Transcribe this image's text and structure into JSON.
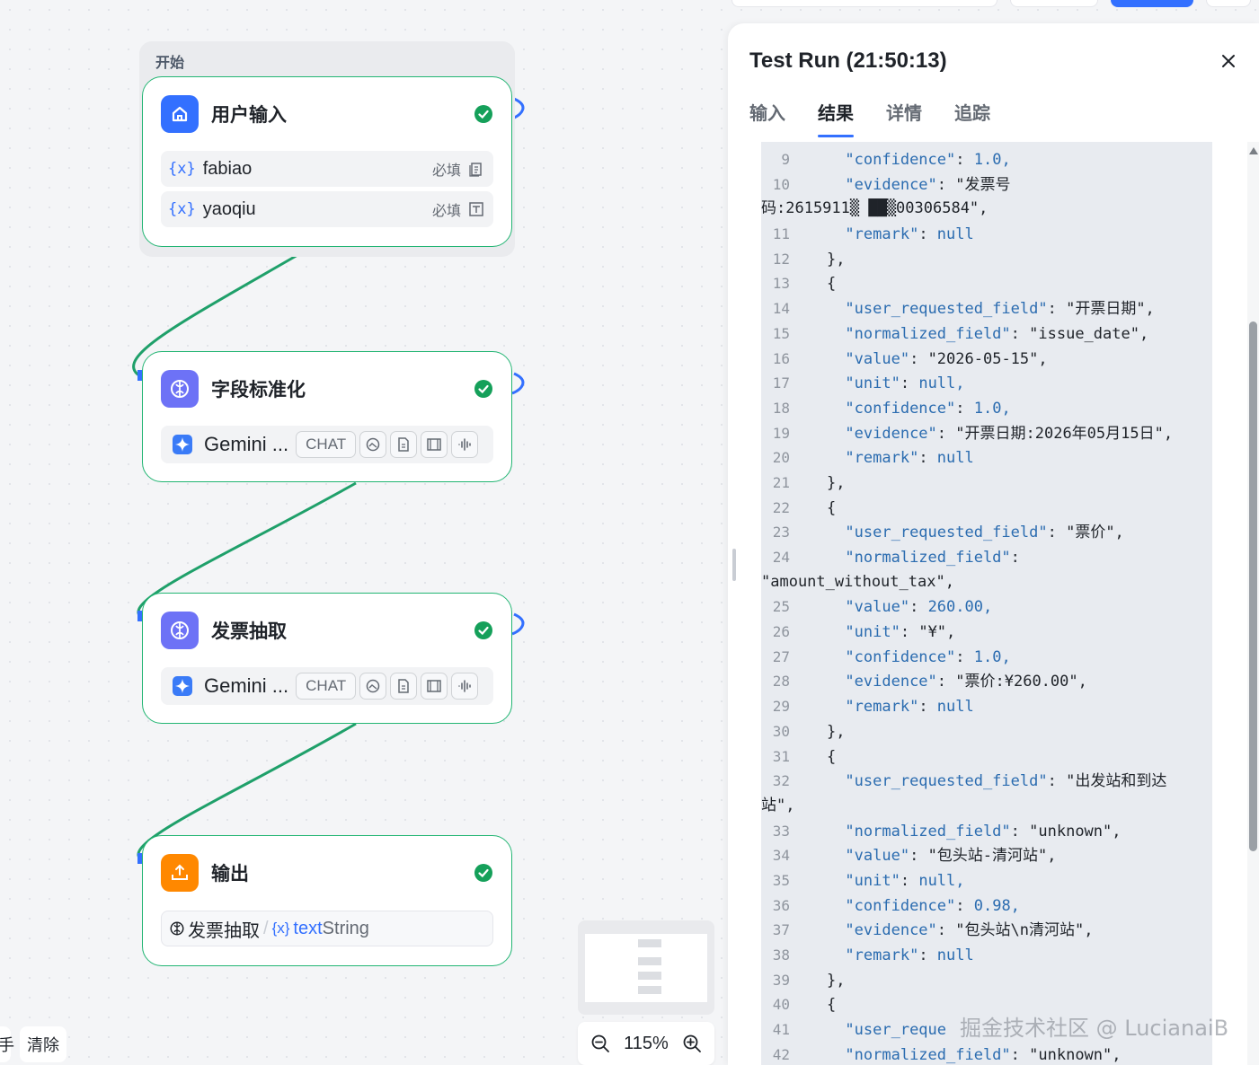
{
  "canvas": {
    "group_label": "开始",
    "nodes": [
      {
        "title": "用户输入",
        "icon": "home-icon",
        "status": "success",
        "inputs": [
          {
            "name": "fabiao",
            "required_label": "必填",
            "type_icon": "document-icon"
          },
          {
            "name": "yaoqiu",
            "required_label": "必填",
            "type_icon": "text-field-icon"
          }
        ]
      },
      {
        "title": "字段标准化",
        "icon": "llm-icon",
        "status": "success",
        "model": {
          "name": "Gemini ...",
          "mode": "CHAT"
        }
      },
      {
        "title": "发票抽取",
        "icon": "llm-icon",
        "status": "success",
        "model": {
          "name": "Gemini ...",
          "mode": "CHAT"
        }
      },
      {
        "title": "输出",
        "icon": "output-icon",
        "status": "success",
        "output": {
          "source": "发票抽取",
          "separator": "/",
          "var": "text",
          "type": "String"
        }
      }
    ],
    "zoom": "115%",
    "clear_label": "清除",
    "left_cut_label": "手"
  },
  "panel": {
    "title": "Test Run (21:50:13)",
    "tabs": [
      "输入",
      "结果",
      "详情",
      "追踪"
    ],
    "active_tab": "结果",
    "code_lines": [
      {
        "ln": "9",
        "indent": "      ",
        "key": "\"confidence\"",
        "val": "1.0,",
        "val_type": "n"
      },
      {
        "ln": "10",
        "indent": "      ",
        "key": "\"evidence\"",
        "val": "\"发票号",
        "val_type": "s"
      },
      {
        "ln": "",
        "indent": "",
        "key": "",
        "val": "码:2615911▒ ██▒00306584\",",
        "val_type": "s"
      },
      {
        "ln": "11",
        "indent": "      ",
        "key": "\"remark\"",
        "val": "null",
        "val_type": "n"
      },
      {
        "ln": "12",
        "indent": "    ",
        "key": "",
        "val": "},",
        "val_type": "s"
      },
      {
        "ln": "13",
        "indent": "    ",
        "key": "",
        "val": "{",
        "val_type": "s"
      },
      {
        "ln": "14",
        "indent": "      ",
        "key": "\"user_requested_field\"",
        "val": "\"开票日期\",",
        "val_type": "s"
      },
      {
        "ln": "15",
        "indent": "      ",
        "key": "\"normalized_field\"",
        "val": "\"issue_date\",",
        "val_type": "s"
      },
      {
        "ln": "16",
        "indent": "      ",
        "key": "\"value\"",
        "val": "\"2026-05-15\",",
        "val_type": "s"
      },
      {
        "ln": "17",
        "indent": "      ",
        "key": "\"unit\"",
        "val": "null,",
        "val_type": "n"
      },
      {
        "ln": "18",
        "indent": "      ",
        "key": "\"confidence\"",
        "val": "1.0,",
        "val_type": "n"
      },
      {
        "ln": "19",
        "indent": "      ",
        "key": "\"evidence\"",
        "val": "\"开票日期:2026年05月15日\",",
        "val_type": "s"
      },
      {
        "ln": "20",
        "indent": "      ",
        "key": "\"remark\"",
        "val": "null",
        "val_type": "n"
      },
      {
        "ln": "21",
        "indent": "    ",
        "key": "",
        "val": "},",
        "val_type": "s"
      },
      {
        "ln": "22",
        "indent": "    ",
        "key": "",
        "val": "{",
        "val_type": "s"
      },
      {
        "ln": "23",
        "indent": "      ",
        "key": "\"user_requested_field\"",
        "val": "\"票价\",",
        "val_type": "s"
      },
      {
        "ln": "24",
        "indent": "      ",
        "key": "\"normalized_field\"",
        "val": "",
        "val_type": "s"
      },
      {
        "ln": "",
        "indent": "",
        "key": "",
        "val": "\"amount_without_tax\",",
        "val_type": "s"
      },
      {
        "ln": "25",
        "indent": "      ",
        "key": "\"value\"",
        "val": "260.00,",
        "val_type": "n"
      },
      {
        "ln": "26",
        "indent": "      ",
        "key": "\"unit\"",
        "val": "\"¥\",",
        "val_type": "s"
      },
      {
        "ln": "27",
        "indent": "      ",
        "key": "\"confidence\"",
        "val": "1.0,",
        "val_type": "n"
      },
      {
        "ln": "28",
        "indent": "      ",
        "key": "\"evidence\"",
        "val": "\"票价:¥260.00\",",
        "val_type": "s"
      },
      {
        "ln": "29",
        "indent": "      ",
        "key": "\"remark\"",
        "val": "null",
        "val_type": "n"
      },
      {
        "ln": "30",
        "indent": "    ",
        "key": "",
        "val": "},",
        "val_type": "s"
      },
      {
        "ln": "31",
        "indent": "    ",
        "key": "",
        "val": "{",
        "val_type": "s"
      },
      {
        "ln": "32",
        "indent": "      ",
        "key": "\"user_requested_field\"",
        "val": "\"出发站和到达",
        "val_type": "s"
      },
      {
        "ln": "",
        "indent": "",
        "key": "",
        "val": "站\",",
        "val_type": "s"
      },
      {
        "ln": "33",
        "indent": "      ",
        "key": "\"normalized_field\"",
        "val": "\"unknown\",",
        "val_type": "s"
      },
      {
        "ln": "34",
        "indent": "      ",
        "key": "\"value\"",
        "val": "\"包头站-清河站\",",
        "val_type": "s"
      },
      {
        "ln": "35",
        "indent": "      ",
        "key": "\"unit\"",
        "val": "null,",
        "val_type": "n"
      },
      {
        "ln": "36",
        "indent": "      ",
        "key": "\"confidence\"",
        "val": "0.98,",
        "val_type": "n"
      },
      {
        "ln": "37",
        "indent": "      ",
        "key": "\"evidence\"",
        "val": "\"包头站\\n清河站\",",
        "val_type": "s"
      },
      {
        "ln": "38",
        "indent": "      ",
        "key": "\"remark\"",
        "val": "null",
        "val_type": "n"
      },
      {
        "ln": "39",
        "indent": "    ",
        "key": "",
        "val": "},",
        "val_type": "s"
      },
      {
        "ln": "40",
        "indent": "    ",
        "key": "",
        "val": "{",
        "val_type": "s"
      },
      {
        "ln": "41",
        "indent": "      ",
        "key": "\"user_reque",
        "val": "",
        "val_type": "s"
      },
      {
        "ln": "42",
        "indent": "      ",
        "key": "\"normalized_field\"",
        "val": "\"unknown\",",
        "val_type": "s"
      }
    ]
  },
  "watermark": "掘金技术社区 @ LucianaiB",
  "colors": {
    "accent": "#3370ff",
    "success": "#22b573",
    "edge": "#1fa06a"
  }
}
